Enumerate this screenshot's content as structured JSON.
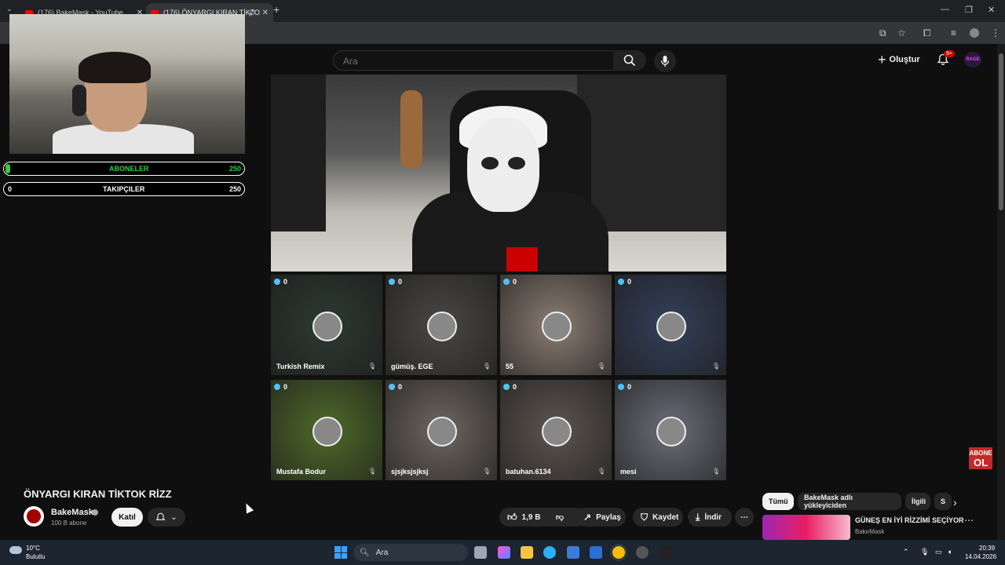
{
  "browser": {
    "tabs": [
      {
        "title": "(176) BakeMask - YouTube"
      },
      {
        "title": "(176) ÖNYARGI KIRAN TİKTO"
      }
    ],
    "new_tab_symbol": "+",
    "close_symbol": "✕",
    "window_controls": {
      "minimize": "—",
      "restore": "❐",
      "close": "✕"
    }
  },
  "masthead": {
    "search_placeholder": "Ara",
    "create_label": "Oluştur",
    "notification_badge": "9+",
    "avatar_label": "RAGE"
  },
  "overlay": {
    "subscribers_label": "ABONELER",
    "subscribers_goal": "250",
    "subscribers_progress": 0.02,
    "followers_current": "0",
    "followers_label": "TAKIPÇILER",
    "followers_goal": "250"
  },
  "live_grid": {
    "guests": [
      {
        "count": "0",
        "name": "Turkish Remix",
        "bg": "#2d3a33"
      },
      {
        "count": "0",
        "name": "gümüş. EGE",
        "bg": "#4a4846"
      },
      {
        "count": "0",
        "name": "55",
        "bg": "#8b7d72"
      },
      {
        "count": "0",
        "name": "",
        "bg": "#34405a"
      },
      {
        "count": "0",
        "name": "Mustafa Bodur",
        "bg": "#4f6a2a"
      },
      {
        "count": "0",
        "name": "sjsjksjsjksj",
        "bg": "#6e6660"
      },
      {
        "count": "0",
        "name": "batuhan.6134",
        "bg": "#5d5550"
      },
      {
        "count": "0",
        "name": "mesi",
        "bg": "#6a6e78"
      }
    ],
    "mic_symbol": "🎙",
    "abone_badge_line1": "ABONE",
    "abone_badge_line2": "OL"
  },
  "video": {
    "title": "ÖNYARGI KIRAN TİKTOK RİZZ",
    "channel_name": "BakeMask",
    "channel_subs": "100 B abone",
    "join_label": "Katıl",
    "likes": "1,9 B",
    "share_label": "Paylaş",
    "save_label": "Kaydet",
    "download_label": "İndir",
    "more_symbol": "⋯"
  },
  "sidebar": {
    "chips": [
      "Tümü",
      "BakeMask adlı yükleyiciden",
      "İlgili",
      "S"
    ],
    "recommended": {
      "title": "GÜNEŞ EN İYİ RİZZİMİ SEÇİYOR",
      "channel": "BakeMask"
    }
  },
  "taskbar": {
    "weather_temp": "10°C",
    "weather_desc": "Bulutlu",
    "search_label": "Ara",
    "time": "20:39",
    "date": "14.04.2026"
  },
  "colors": {
    "accent_red": "#ff0000",
    "progress_green": "#2ecc40",
    "background": "#0f0f0f"
  }
}
